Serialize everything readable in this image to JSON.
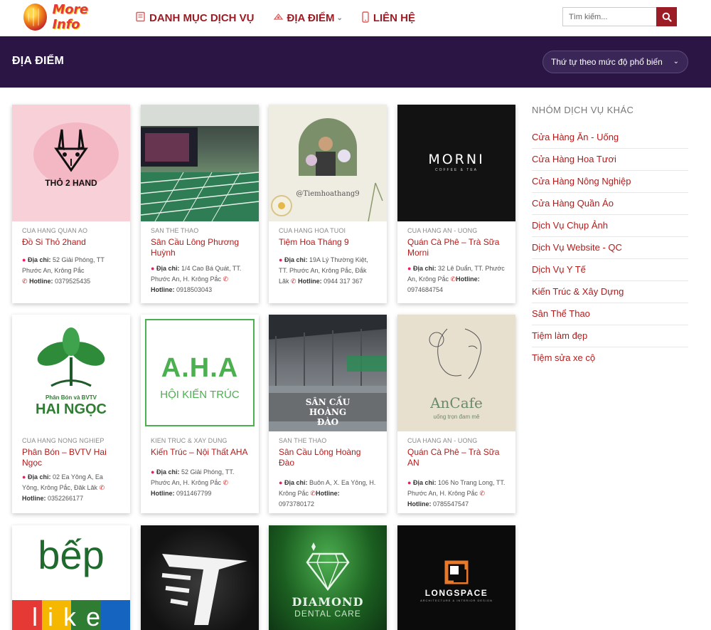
{
  "brand": {
    "name": "More Info"
  },
  "nav": [
    {
      "label": "DANH MỤC DỊCH VỤ",
      "icon": "book-icon"
    },
    {
      "label": "ĐỊA ĐIỂM",
      "icon": "location-icon"
    },
    {
      "label": "LIÊN HỆ",
      "icon": "phone-icon"
    }
  ],
  "search": {
    "placeholder": "Tìm kiếm..."
  },
  "page": {
    "title": "ĐỊA ĐIỂM",
    "sort_label": "Thứ tự theo mức độ phổ biến"
  },
  "cards": [
    {
      "category": "CUA HANG QUAN AO",
      "title": "Đồ Si Thỏ 2hand",
      "address": "52 Giải Phóng, TT Phước An, Krông Pắc",
      "hotline": "0379525435",
      "thumb_text": "THỎ 2 HAND"
    },
    {
      "category": "SAN THE THAO",
      "title": "Sân Cầu Lông Phương Huỳnh",
      "address": "1/4 Cao Bá Quát, TT. Phước An, H. Krông Pắc",
      "hotline": "0918503043",
      "thumb_text": ""
    },
    {
      "category": "CUA HANG HOA TUOI",
      "title": "Tiệm Hoa Tháng 9",
      "address": "19A Lý Thường Kiệt, TT. Phước An, Krông Pắc, Đắk Lăk",
      "hotline": "0944 317 367",
      "thumb_text": "@Tiemhoathang9"
    },
    {
      "category": "CUA HANG AN - UONG",
      "title": "Quán Cà Phê – Trà Sữa Morni",
      "address": "32 Lê Duẩn, TT. Phước An, Krông Pắc",
      "hotline": "0974684754",
      "thumb_text": "MORNI",
      "thumb_sub": "COFFEE & TEA"
    },
    {
      "category": "CUA HANG NONG NGHIEP",
      "title": "Phân Bón – BVTV Hai Ngọc",
      "address": "02 Ea Yông A, Ea Yông, Krông Pắc, Đăk Lăk",
      "hotline": "0352266177",
      "thumb_text": "HAI NGỌC",
      "thumb_sub": "Phân Bón và BVTV"
    },
    {
      "category": "KIEN TRUC & XAY DUNG",
      "title": "Kiến Trúc – Nội Thất AHA",
      "address": "52 Giải Phóng, TT. Phước An, H. Krông Pắc",
      "hotline": "0911467799",
      "thumb_text": "A.H.A",
      "thumb_sub": "HỘI KIẾN TRÚC"
    },
    {
      "category": "SAN THE THAO",
      "title": "Sân Cầu Lông Hoàng Đào",
      "address": "Buôn A, X. Ea Yông, H. Krông Pắc",
      "hotline": "0973780172",
      "thumb_text": "SÂN CẦU HOÀNG ĐÀO"
    },
    {
      "category": "CUA HANG AN - UONG",
      "title": "Quán Cà Phê – Trà Sữa AN",
      "address": "106 No Trang Long, TT. Phước An, H. Krông Pắc",
      "hotline": "0785547547",
      "thumb_text": "AnCafe",
      "thumb_sub": "uống trọn đam mê"
    },
    {
      "thumb_text": "bếp",
      "thumb_sub": "like"
    },
    {
      "thumb_text": ""
    },
    {
      "thumb_text": "DIAMOND",
      "thumb_sub": "DENTAL CARE"
    },
    {
      "thumb_text": "LONGSPACE",
      "thumb_sub": "ARCHITECTURE & INTERIOR DESIGN"
    }
  ],
  "labels": {
    "address": "Địa chỉ:",
    "hotline": "Hotline:"
  },
  "sidebar": {
    "heading": "NHÓM DỊCH VỤ KHÁC",
    "items": [
      "Cửa Hàng Ăn - Uống",
      "Cửa Hàng Hoa Tươi",
      "Cửa Hàng Nông Nghiệp",
      "Cửa Hàng Quần Áo",
      "Dịch Vụ Chụp Ảnh",
      "Dịch Vụ Website - QC",
      "Dịch Vụ Y Tế",
      "Kiến Trúc & Xây Dựng",
      "Sân Thể Thao",
      "Tiệm làm đẹp",
      "Tiệm sửa xe cộ"
    ]
  },
  "colors": {
    "accent": "#9b1c24",
    "band": "#2b1545",
    "link": "#b31b1b"
  }
}
